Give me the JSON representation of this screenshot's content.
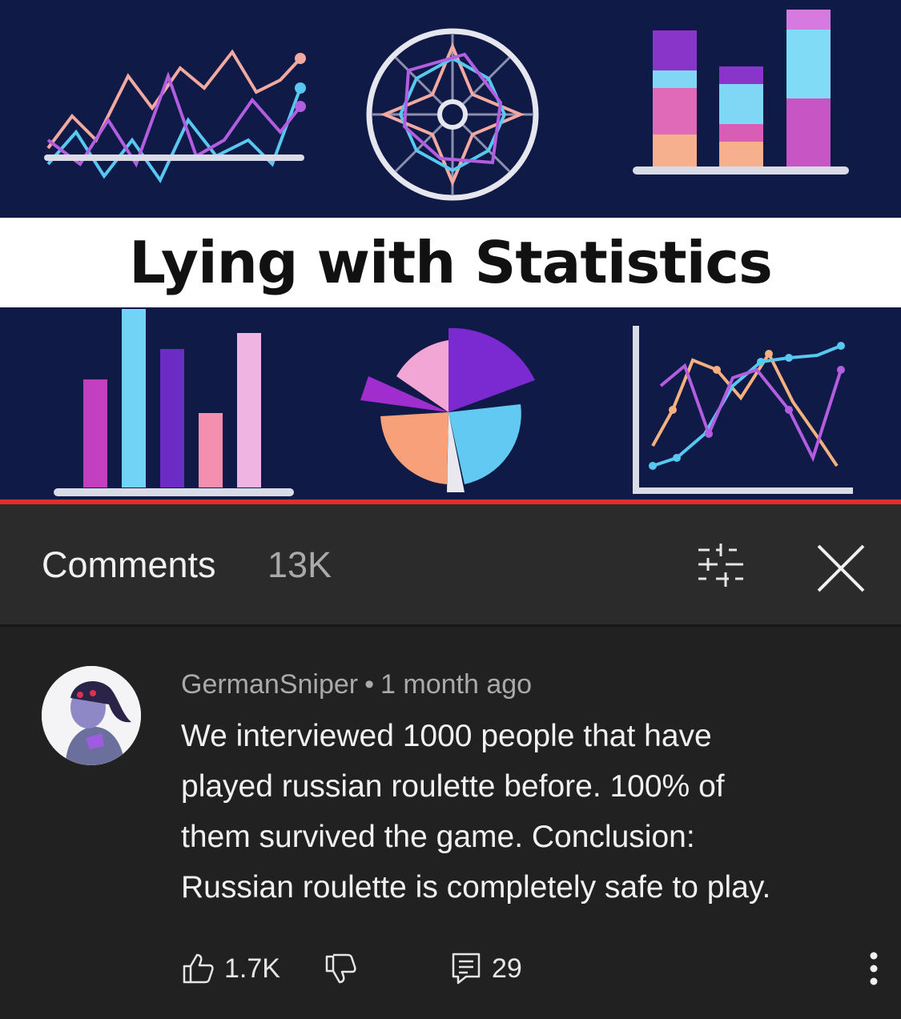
{
  "video": {
    "thumbnail_title": "Lying with Statistics",
    "progress_fraction": 1.0
  },
  "comments_header": {
    "title": "Comments",
    "count": "13K",
    "sort_icon": "sort-filter-icon",
    "close_icon": "close-icon"
  },
  "comment": {
    "author": "GermanSniper",
    "separator": "•",
    "time": "1 month ago",
    "text": "We interviewed 1000 people that have\nplayed russian roulette before. 100% of\nthem survived the game. Conclusion:\nRussian roulette is completely safe to play.",
    "likes": "1.7K",
    "replies": "29",
    "icons": [
      "thumbs-up-icon",
      "thumbs-down-icon",
      "reply-icon",
      "more-vertical-icon"
    ]
  },
  "colors": {
    "thumbnail_bg": "#0f1a47",
    "panel_bg": "#212121",
    "header_bg": "#2b2b2b",
    "progress": "#e52d27"
  }
}
